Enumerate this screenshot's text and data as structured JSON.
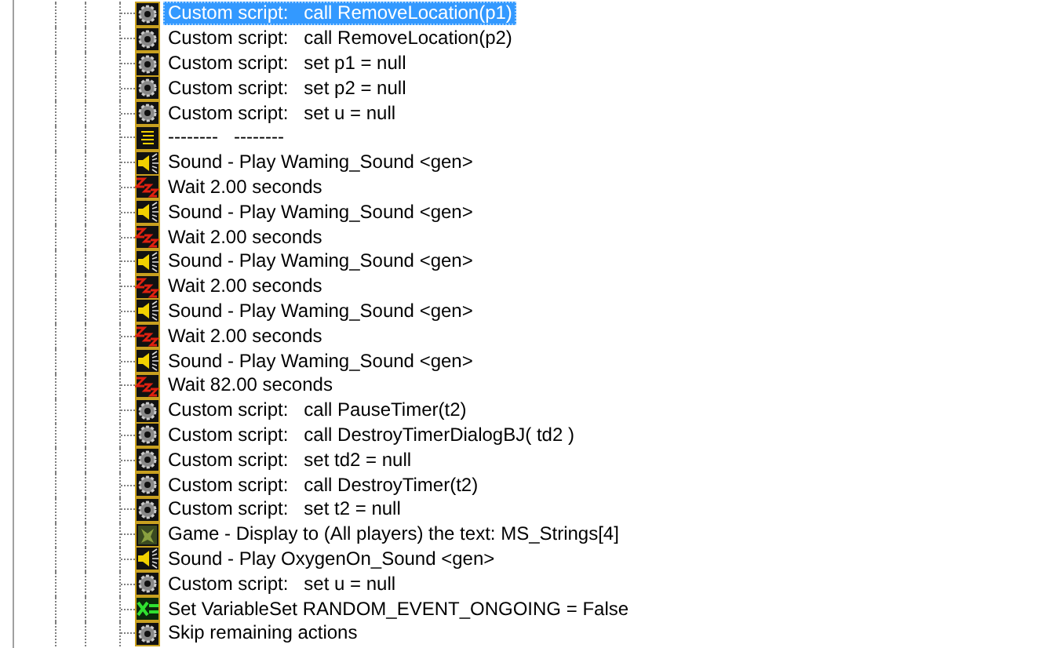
{
  "actions": [
    {
      "kind": "script",
      "text": "Custom script:   call RemoveLocation(p1)",
      "selected": true
    },
    {
      "kind": "script",
      "text": "Custom script:   call RemoveLocation(p2)",
      "selected": false
    },
    {
      "kind": "script",
      "text": "Custom script:   set p1 = null",
      "selected": false
    },
    {
      "kind": "script",
      "text": "Custom script:   set p2 = null",
      "selected": false
    },
    {
      "kind": "script",
      "text": "Custom script:   set u = null",
      "selected": false
    },
    {
      "kind": "comment",
      "text": "--------   --------",
      "selected": false
    },
    {
      "kind": "sound",
      "text": "Sound - Play Waming_Sound <gen>",
      "selected": false
    },
    {
      "kind": "wait",
      "text": "Wait 2.00 seconds",
      "selected": false
    },
    {
      "kind": "sound",
      "text": "Sound - Play Waming_Sound <gen>",
      "selected": false
    },
    {
      "kind": "wait",
      "text": "Wait 2.00 seconds",
      "selected": false
    },
    {
      "kind": "sound",
      "text": "Sound - Play Waming_Sound <gen>",
      "selected": false
    },
    {
      "kind": "wait",
      "text": "Wait 2.00 seconds",
      "selected": false
    },
    {
      "kind": "sound",
      "text": "Sound - Play Waming_Sound <gen>",
      "selected": false
    },
    {
      "kind": "wait",
      "text": "Wait 2.00 seconds",
      "selected": false
    },
    {
      "kind": "sound",
      "text": "Sound - Play Waming_Sound <gen>",
      "selected": false
    },
    {
      "kind": "wait",
      "text": "Wait 82.00 seconds",
      "selected": false
    },
    {
      "kind": "script",
      "text": "Custom script:   call PauseTimer(t2)",
      "selected": false
    },
    {
      "kind": "script",
      "text": "Custom script:   call DestroyTimerDialogBJ( td2 )",
      "selected": false
    },
    {
      "kind": "script",
      "text": "Custom script:   set td2 = null",
      "selected": false
    },
    {
      "kind": "script",
      "text": "Custom script:   call DestroyTimer(t2)",
      "selected": false
    },
    {
      "kind": "script",
      "text": "Custom script:   set t2 = null",
      "selected": false
    },
    {
      "kind": "game",
      "text": "Game - Display to (All players) the text: MS_Strings[4]",
      "selected": false
    },
    {
      "kind": "sound",
      "text": "Sound - Play OxygenOn_Sound <gen>",
      "selected": false
    },
    {
      "kind": "script",
      "text": "Custom script:   set u = null",
      "selected": false
    },
    {
      "kind": "setvar",
      "text": "Set VariableSet RANDOM_EVENT_ONGOING = False",
      "selected": false
    },
    {
      "kind": "script",
      "text": "Skip remaining actions",
      "selected": false
    }
  ]
}
